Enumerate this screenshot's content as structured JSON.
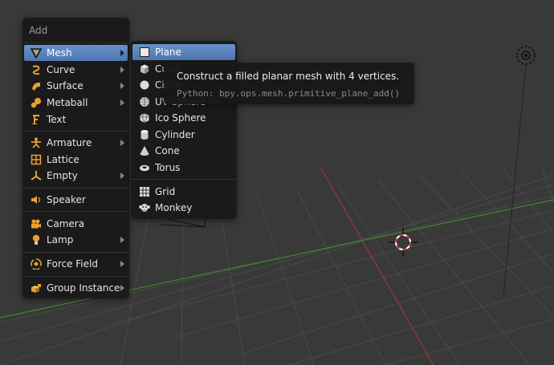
{
  "add_menu": {
    "title": "Add",
    "items": [
      {
        "label": "Mesh",
        "icon": "mesh-icon",
        "submenu": true,
        "active": true
      },
      {
        "label": "Curve",
        "icon": "curve-icon",
        "submenu": true
      },
      {
        "label": "Surface",
        "icon": "surface-icon",
        "submenu": true
      },
      {
        "label": "Metaball",
        "icon": "metaball-icon",
        "submenu": true
      },
      {
        "label": "Text",
        "icon": "text-icon",
        "submenu": false
      },
      {
        "label": "Armature",
        "icon": "armature-icon",
        "submenu": true
      },
      {
        "label": "Lattice",
        "icon": "lattice-icon",
        "submenu": false
      },
      {
        "label": "Empty",
        "icon": "empty-icon",
        "submenu": true
      },
      {
        "label": "Speaker",
        "icon": "speaker-icon",
        "submenu": false
      },
      {
        "label": "Camera",
        "icon": "camera-icon",
        "submenu": false
      },
      {
        "label": "Lamp",
        "icon": "lamp-icon",
        "submenu": true
      },
      {
        "label": "Force Field",
        "icon": "force-field-icon",
        "submenu": true
      },
      {
        "label": "Group Instance",
        "icon": "group-instance-icon",
        "submenu": true
      }
    ]
  },
  "mesh_submenu": {
    "items": [
      {
        "label": "Plane",
        "icon": "plane-icon",
        "active": true
      },
      {
        "label": "Cube",
        "icon": "cube-icon"
      },
      {
        "label": "Circle",
        "icon": "circle-icon"
      },
      {
        "label": "UV Sphere",
        "icon": "uv-sphere-icon"
      },
      {
        "label": "Ico Sphere",
        "icon": "ico-sphere-icon"
      },
      {
        "label": "Cylinder",
        "icon": "cylinder-icon"
      },
      {
        "label": "Cone",
        "icon": "cone-icon"
      },
      {
        "label": "Torus",
        "icon": "torus-icon"
      },
      {
        "label": "Grid",
        "icon": "grid-icon"
      },
      {
        "label": "Monkey",
        "icon": "monkey-icon"
      }
    ]
  },
  "tooltip": {
    "description": "Construct a filled planar mesh with 4 vertices.",
    "python": "Python: bpy.ops.mesh.primitive_plane_add()"
  },
  "colors": {
    "background": "#393939",
    "grid_line": "#4a4a4a",
    "x_axis": "#9a3838",
    "y_axis": "#3f8a2d",
    "menu_highlight": "#5a82bc",
    "icon_orange": "#e8a033"
  }
}
